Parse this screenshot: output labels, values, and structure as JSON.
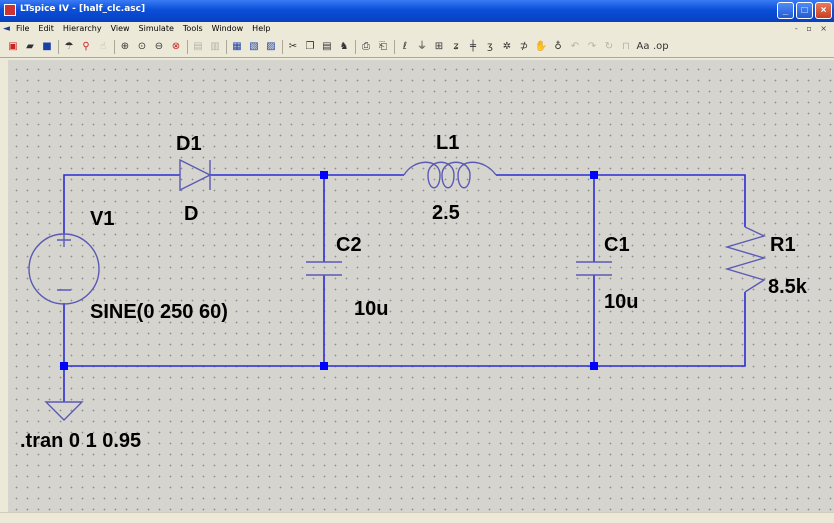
{
  "window": {
    "title": "LTspice IV - [half_clc.asc]"
  },
  "menu": [
    "File",
    "Edit",
    "Hierarchy",
    "View",
    "Simulate",
    "Tools",
    "Window",
    "Help"
  ],
  "schematic": {
    "components": [
      {
        "ref": "D1",
        "value": "D"
      },
      {
        "ref": "L1",
        "value": "2.5"
      },
      {
        "ref": "V1",
        "value": "SINE(0 250 60)"
      },
      {
        "ref": "C2",
        "value": "10u"
      },
      {
        "ref": "C1",
        "value": "10u"
      },
      {
        "ref": "R1",
        "value": "8.5k"
      }
    ],
    "directive": ".tran 0 1 0.95"
  },
  "colors": {
    "wire": "#2b2bd6",
    "junction": "#0000ff",
    "component": "#5a5ab5",
    "titlebar": "#0a4fd8"
  }
}
